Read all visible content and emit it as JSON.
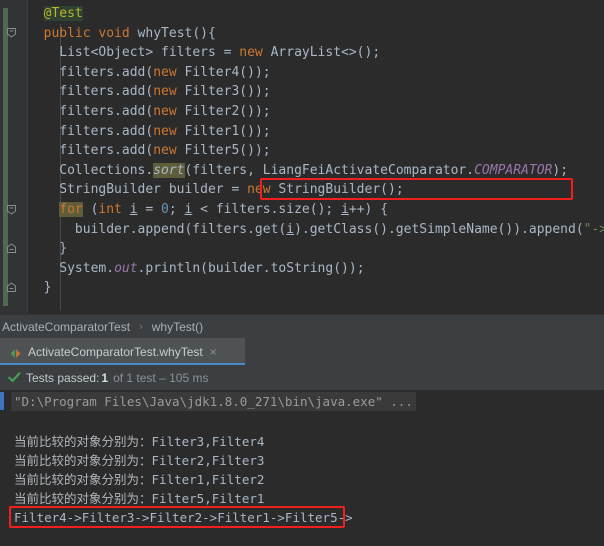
{
  "editor": {
    "lines": [
      {
        "indent": 0,
        "tokens": [],
        "cut": true
      },
      {
        "indent": 2,
        "tokens": [
          {
            "t": "@Test",
            "c": "anno"
          }
        ]
      },
      {
        "indent": 2,
        "tokens": [
          {
            "t": "public",
            "c": "kw"
          },
          {
            "t": " ",
            "c": "pln"
          },
          {
            "t": "void",
            "c": "kw"
          },
          {
            "t": " whyTest(){",
            "c": "pln"
          }
        ]
      },
      {
        "indent": 4,
        "tokens": [
          {
            "t": "List<Object> filters = ",
            "c": "pln"
          },
          {
            "t": "new",
            "c": "kw"
          },
          {
            "t": " ArrayList<>();",
            "c": "pln"
          }
        ]
      },
      {
        "indent": 4,
        "tokens": [
          {
            "t": "filters.add(",
            "c": "pln"
          },
          {
            "t": "new",
            "c": "kw"
          },
          {
            "t": " Filter4());",
            "c": "pln"
          }
        ]
      },
      {
        "indent": 4,
        "tokens": [
          {
            "t": "filters.add(",
            "c": "pln"
          },
          {
            "t": "new",
            "c": "kw"
          },
          {
            "t": " Filter3());",
            "c": "pln"
          }
        ]
      },
      {
        "indent": 4,
        "tokens": [
          {
            "t": "filters.add(",
            "c": "pln"
          },
          {
            "t": "new",
            "c": "kw"
          },
          {
            "t": " Filter2());",
            "c": "pln"
          }
        ]
      },
      {
        "indent": 4,
        "tokens": [
          {
            "t": "filters.add(",
            "c": "pln"
          },
          {
            "t": "new",
            "c": "kw"
          },
          {
            "t": " Filter1());",
            "c": "pln"
          }
        ]
      },
      {
        "indent": 4,
        "tokens": [
          {
            "t": "filters.add(",
            "c": "pln"
          },
          {
            "t": "new",
            "c": "kw"
          },
          {
            "t": " Filter5());",
            "c": "pln"
          }
        ]
      },
      {
        "indent": 4,
        "tokens": [
          {
            "t": "Collections.",
            "c": "pln"
          },
          {
            "t": "sort",
            "c": "meth-hl"
          },
          {
            "t": "(filters, LiangFeiActivateComparator.",
            "c": "pln"
          },
          {
            "t": "COMPARATOR",
            "c": "stat"
          },
          {
            "t": ");",
            "c": "pln"
          }
        ]
      },
      {
        "indent": 4,
        "tokens": [
          {
            "t": "StringBuilder builder = ",
            "c": "pln"
          },
          {
            "t": "new",
            "c": "kw"
          },
          {
            "t": " StringBuilder();",
            "c": "pln"
          }
        ]
      },
      {
        "indent": 4,
        "tokens": [
          {
            "t": "for",
            "c": "kw-hl"
          },
          {
            "t": " (",
            "c": "pln"
          },
          {
            "t": "int",
            "c": "kw"
          },
          {
            "t": " ",
            "c": "pln"
          },
          {
            "t": "i",
            "c": "var-u"
          },
          {
            "t": " = ",
            "c": "pln"
          },
          {
            "t": "0",
            "c": "num"
          },
          {
            "t": "; ",
            "c": "pln"
          },
          {
            "t": "i",
            "c": "var-u"
          },
          {
            "t": " < filters.size(); ",
            "c": "pln"
          },
          {
            "t": "i",
            "c": "var-u"
          },
          {
            "t": "++) {",
            "c": "pln"
          }
        ]
      },
      {
        "indent": 6,
        "tokens": [
          {
            "t": "builder.append(filters.get(",
            "c": "pln"
          },
          {
            "t": "i",
            "c": "var-u"
          },
          {
            "t": ").getClass().getSimpleName()).append(",
            "c": "pln"
          },
          {
            "t": "\"->\"",
            "c": "str"
          },
          {
            "t": ");",
            "c": "pln"
          }
        ]
      },
      {
        "indent": 4,
        "tokens": [
          {
            "t": "}",
            "c": "pln"
          }
        ]
      },
      {
        "indent": 4,
        "tokens": [
          {
            "t": "System.",
            "c": "pln"
          },
          {
            "t": "out",
            "c": "stat"
          },
          {
            "t": ".println(builder.toString());",
            "c": "pln"
          }
        ]
      },
      {
        "indent": 2,
        "tokens": [
          {
            "t": "}",
            "c": "pln"
          }
        ]
      }
    ],
    "highlight_box_label": "LiangFeiActivateComparator.COMPARATOR);"
  },
  "breadcrumb": {
    "class_name": "ActivateComparatorTest",
    "separator": "›",
    "method_name": "whyTest()"
  },
  "run_tab": {
    "label": "ActivateComparatorTest.whyTest",
    "close_glyph": "×"
  },
  "test_status": {
    "prefix": "Tests passed:",
    "count": "1",
    "suffix": "of 1 test – 105 ms"
  },
  "console": {
    "command": "\"D:\\Program Files\\Java\\jdk1.8.0_271\\bin\\java.exe\" ...",
    "comparison_lines": [
      {
        "label": "当前比较的对象分别为：",
        "value": "Filter3,Filter4"
      },
      {
        "label": "当前比较的对象分别为：",
        "value": "Filter2,Filter3"
      },
      {
        "label": "当前比较的对象分别为：",
        "value": "Filter1,Filter2"
      },
      {
        "label": "当前比较的对象分别为：",
        "value": "Filter5,Filter1"
      }
    ],
    "result_line": "Filter4->Filter3->Filter2->Filter1->Filter5->"
  },
  "colors": {
    "editor_bg": "#2b2b2b",
    "gutter_bg": "#313335",
    "panel_bg": "#3c3f41",
    "annotation_red": "#f21f1f",
    "change_stripe_green": "#4f6a52",
    "tab_underline_blue": "#4a88c7",
    "keyword_orange": "#cc7832",
    "string_green": "#6a8759",
    "static_purple": "#9876aa",
    "number_blue": "#6897bb",
    "text_gray": "#a9b7c6"
  }
}
